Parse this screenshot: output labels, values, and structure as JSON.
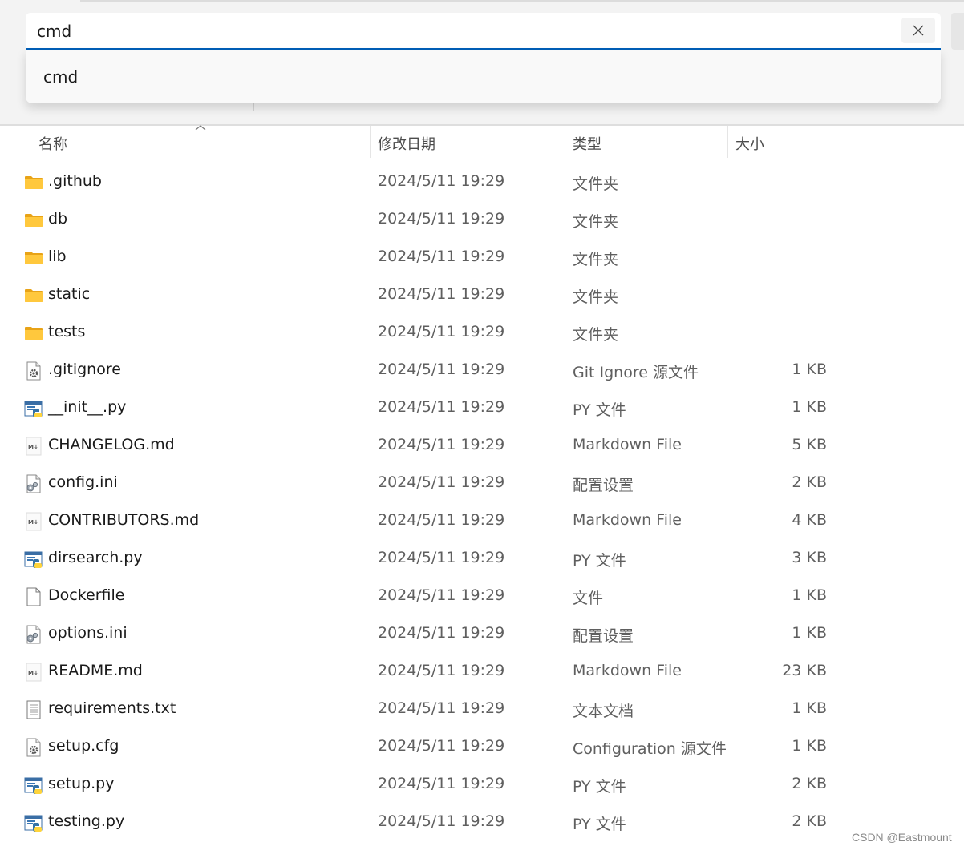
{
  "search": {
    "query": "cmd",
    "clear_icon": "close-icon"
  },
  "suggestions": [
    {
      "label": "cmd"
    }
  ],
  "columns": {
    "name": "名称",
    "modified": "修改日期",
    "type": "类型",
    "size": "大小"
  },
  "files": [
    {
      "name": ".github",
      "modified": "2024/5/11 19:29",
      "type": "文件夹",
      "size": "",
      "icon": "folder-icon"
    },
    {
      "name": "db",
      "modified": "2024/5/11 19:29",
      "type": "文件夹",
      "size": "",
      "icon": "folder-icon"
    },
    {
      "name": "lib",
      "modified": "2024/5/11 19:29",
      "type": "文件夹",
      "size": "",
      "icon": "folder-icon"
    },
    {
      "name": "static",
      "modified": "2024/5/11 19:29",
      "type": "文件夹",
      "size": "",
      "icon": "folder-icon"
    },
    {
      "name": "tests",
      "modified": "2024/5/11 19:29",
      "type": "文件夹",
      "size": "",
      "icon": "folder-icon"
    },
    {
      "name": ".gitignore",
      "modified": "2024/5/11 19:29",
      "type": "Git Ignore 源文件",
      "size": "1 KB",
      "icon": "config-file-icon"
    },
    {
      "name": "__init__.py",
      "modified": "2024/5/11 19:29",
      "type": "PY 文件",
      "size": "1 KB",
      "icon": "python-file-icon"
    },
    {
      "name": "CHANGELOG.md",
      "modified": "2024/5/11 19:29",
      "type": "Markdown File",
      "size": "5 KB",
      "icon": "markdown-file-icon"
    },
    {
      "name": "config.ini",
      "modified": "2024/5/11 19:29",
      "type": "配置设置",
      "size": "2 KB",
      "icon": "settings-file-icon"
    },
    {
      "name": "CONTRIBUTORS.md",
      "modified": "2024/5/11 19:29",
      "type": "Markdown File",
      "size": "4 KB",
      "icon": "markdown-file-icon"
    },
    {
      "name": "dirsearch.py",
      "modified": "2024/5/11 19:29",
      "type": "PY 文件",
      "size": "3 KB",
      "icon": "python-file-icon"
    },
    {
      "name": "Dockerfile",
      "modified": "2024/5/11 19:29",
      "type": "文件",
      "size": "1 KB",
      "icon": "blank-file-icon"
    },
    {
      "name": "options.ini",
      "modified": "2024/5/11 19:29",
      "type": "配置设置",
      "size": "1 KB",
      "icon": "settings-file-icon"
    },
    {
      "name": "README.md",
      "modified": "2024/5/11 19:29",
      "type": "Markdown File",
      "size": "23 KB",
      "icon": "markdown-file-icon"
    },
    {
      "name": "requirements.txt",
      "modified": "2024/5/11 19:29",
      "type": "文本文档",
      "size": "1 KB",
      "icon": "text-file-icon"
    },
    {
      "name": "setup.cfg",
      "modified": "2024/5/11 19:29",
      "type": "Configuration 源文件",
      "size": "1 KB",
      "icon": "config-file-icon"
    },
    {
      "name": "setup.py",
      "modified": "2024/5/11 19:29",
      "type": "PY 文件",
      "size": "2 KB",
      "icon": "python-file-icon"
    },
    {
      "name": "testing.py",
      "modified": "2024/5/11 19:29",
      "type": "PY 文件",
      "size": "2 KB",
      "icon": "python-file-icon"
    }
  ],
  "watermark": "CSDN @Eastmount",
  "colors": {
    "accent": "#005fb8",
    "folder": "#ffc83d",
    "folder_dark": "#e8a317"
  }
}
